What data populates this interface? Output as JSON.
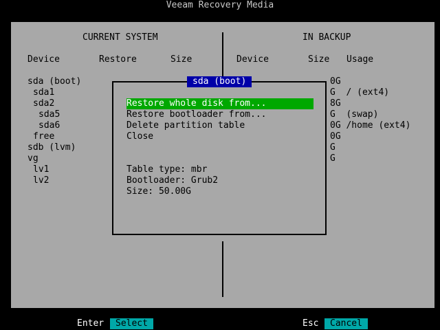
{
  "window_title": "Veeam Recovery Media",
  "current_system": {
    "heading": "CURRENT SYSTEM",
    "columns": [
      "Device",
      "Restore",
      "Size"
    ],
    "devices": [
      "sda (boot)",
      "sda1",
      "sda2",
      "sda5",
      "sda6",
      "free",
      "sdb (lvm)",
      "vg",
      "lv1",
      "lv2"
    ]
  },
  "in_backup": {
    "heading": "IN BACKUP",
    "columns": [
      "Device",
      "Size",
      "Usage"
    ],
    "visible_rows": [
      "0G",
      "G  / (ext4)",
      "8G",
      "G  (swap)",
      "0G /home (ext4)",
      "0G",
      "G",
      "G"
    ]
  },
  "dialog": {
    "title": "sda (boot)",
    "menu": [
      "Restore whole disk from...",
      "Restore bootloader from...",
      "Delete partition table",
      "Close"
    ],
    "info": [
      "Table type: mbr",
      "Bootloader: Grub2",
      "Size: 50.00G"
    ]
  },
  "footer": {
    "enter_key": "Enter",
    "enter_action": "Select",
    "esc_key": "Esc",
    "esc_action": "Cancel"
  },
  "colors": {
    "panel": "#a8a8a8",
    "dialog_title_bg": "#0000a8",
    "selected_item_bg": "#00a800",
    "button_bg": "#00a8a8"
  }
}
